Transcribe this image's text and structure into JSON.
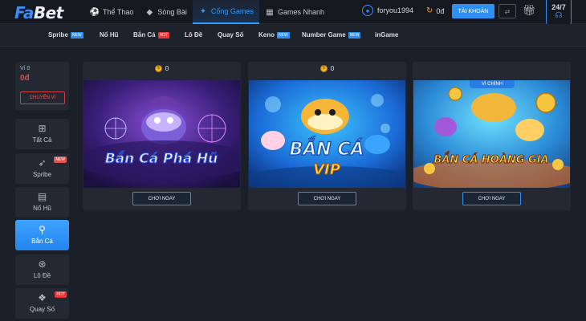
{
  "header": {
    "logo_a": "Fa",
    "logo_b": "Bet",
    "nav": [
      {
        "label": "Thể Thao",
        "icon": "soccer-ball-icon"
      },
      {
        "label": "Sòng Bài",
        "icon": "diamond-icon"
      },
      {
        "label": "Cổng Games",
        "icon": "gamepad-icon",
        "active": true
      },
      {
        "label": "Games Nhanh",
        "icon": "grid-icon"
      }
    ],
    "username": "foryou1994",
    "balance": "0đ",
    "account_button": "TÀI KHOẢN",
    "support": "24/7"
  },
  "subnav": [
    {
      "label": "Spribe",
      "badge": "NEW"
    },
    {
      "label": "Nổ Hũ",
      "badge": ""
    },
    {
      "label": "Bắn Cá",
      "badge": "HOT"
    },
    {
      "label": "Lô Đề",
      "badge": ""
    },
    {
      "label": "Quay Số",
      "badge": ""
    },
    {
      "label": "Keno",
      "badge": "NEW"
    },
    {
      "label": "Number Game",
      "badge": "NEW"
    },
    {
      "label": "inGame",
      "badge": ""
    }
  ],
  "wallet": {
    "label": "Ví 0",
    "amount": "0đ",
    "transfer_button": "CHUYỂN VÍ"
  },
  "sidebar": [
    {
      "label": "Tất Cả",
      "icon": "grid-icon",
      "badge": ""
    },
    {
      "label": "Spribe",
      "icon": "rocket-icon",
      "badge": "NEW"
    },
    {
      "label": "Nổ Hũ",
      "icon": "slot-machine-icon",
      "badge": ""
    },
    {
      "label": "Bắn Cá",
      "icon": "fishing-hook-icon",
      "badge": "",
      "active": true
    },
    {
      "label": "Lô Đề",
      "icon": "lottery-ball-icon",
      "badge": ""
    },
    {
      "label": "Quay Số",
      "icon": "ticket-icon",
      "badge": "HOT"
    }
  ],
  "games": [
    {
      "jackpot": "0",
      "title_line1": "Bắn Cá Phá Hũ",
      "title_line2": "",
      "tag": "",
      "play": "CHƠI NGAY"
    },
    {
      "jackpot": "0",
      "title_line1": "BẮN CÁ",
      "title_line2": "VIP",
      "tag": "",
      "play": "CHƠI NGAY"
    },
    {
      "jackpot": "",
      "title_line1": "BẮN CÁ HOÀNG GIA",
      "title_line2": "",
      "tag": "VÍ CHÍNH",
      "play": "CHƠI NGAY"
    }
  ],
  "colors": {
    "accent": "#2f8ff3",
    "hot": "#e63a3a",
    "balance_red": "#e24848",
    "bg": "#1b1f27"
  }
}
